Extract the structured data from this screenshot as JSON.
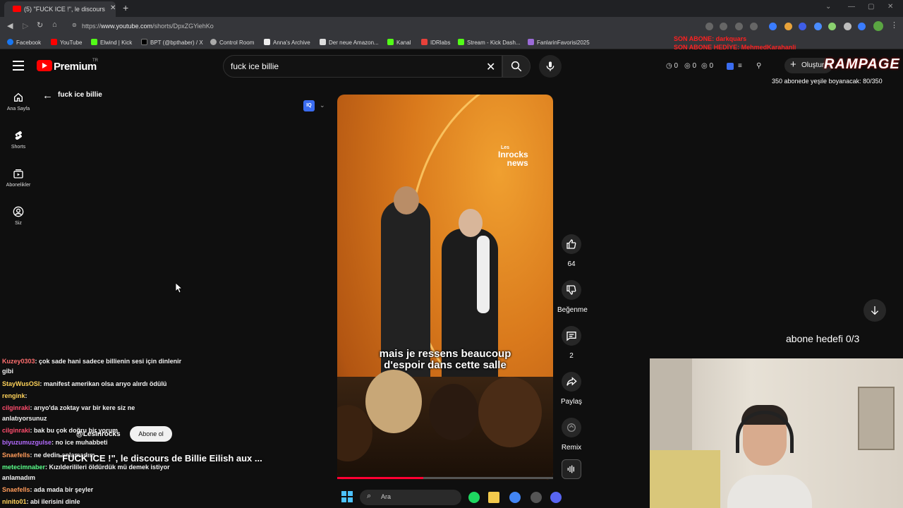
{
  "browser": {
    "tab_title": "(5) \"FUCK ICE !\", le discours",
    "url_prefix": "https://",
    "url_host": "www.youtube.com",
    "url_path": "/shorts/DpxZGYiehKo",
    "bookmarks": [
      "Facebook",
      "YouTube",
      "Elwind | Kick",
      "BPT (@bpthaber) / X",
      "Control Room",
      "Anna's Archive",
      "Der neue Amazon...",
      "Kanal",
      "IDRlabs",
      "Stream - Kick Dash...",
      "FanlarinFavorisi2025"
    ]
  },
  "header": {
    "brand": "Premium",
    "region": "TR",
    "search_value": "fuck ice billie",
    "stats": [
      "0",
      "0",
      "0"
    ],
    "create_label": "Oluştur"
  },
  "sidebar": {
    "items": [
      {
        "label": "Ana Sayfa",
        "icon": "home-icon"
      },
      {
        "label": "Shorts",
        "icon": "shorts-icon"
      },
      {
        "label": "Abonelikler",
        "icon": "subscriptions-icon"
      },
      {
        "label": "Siz",
        "icon": "account-icon"
      }
    ]
  },
  "page": {
    "title": "fuck ice billie"
  },
  "video": {
    "watermark_line1": "Les",
    "watermark_line2": "Inrocks",
    "watermark_line3": "news",
    "caption_line1": "mais je ressens beaucoup",
    "caption_line2": "d'espoir dans cette salle",
    "progress": 0.4,
    "channel": "@LesInrocks",
    "subscribe_label": "Abone ol",
    "title": "\"FUCK ICE !\", le discours de Billie Eilish aux ..."
  },
  "actions": {
    "like_count": "64",
    "dislike_label": "Beğenme",
    "comment_count": "2",
    "share_label": "Paylaş",
    "remix_label": "Remix"
  },
  "overlay": {
    "son_abone_1": "SON ABONE: darkquars",
    "son_abone_2": "SON ABONE HEDİYE: MehmedKarahanli",
    "rampage": "RAMPAGE",
    "goal_text": "350 abonede yeşile boyanacak: 80/350",
    "abone_hedefi": "abone hedefi 0/3"
  },
  "chat": [
    {
      "user": "Kuzey0303",
      "msg": ": çok sade hani sadece billienin sesi için dinlenir",
      "color": "#ff6f6f"
    },
    {
      "user": "",
      "msg": "gibi",
      "color": "#ffffff"
    },
    {
      "user": "StayWusOSI",
      "msg": ": manifest amerikan olsa arıyo alırdı ödülü",
      "color": "#ffd35a"
    },
    {
      "user": "rengink",
      "msg": ":",
      "color": "#ffd35a"
    },
    {
      "user": "cilginraki",
      "msg": ": arıyo'da zoktay var bir kere siz ne",
      "color": "#ff4d6d"
    },
    {
      "user": "",
      "msg": "anlatıyorsunuz",
      "color": "#ffffff"
    },
    {
      "user": "cilginraki",
      "msg": ": bak bu çok doğru bir yorum",
      "color": "#ff4d6d"
    },
    {
      "user": "biyuzumuzgulse",
      "msg": ": no ice muhabbeti",
      "color": "#b46bff"
    },
    {
      "user": "Snaefells",
      "msg": ": ne dedin anlamadım",
      "color": "#ff9b5a"
    },
    {
      "user": "metecimnaber",
      "msg": ": Kızılderilileri öldürdük mü demek istiyor",
      "color": "#5aff8a"
    },
    {
      "user": "",
      "msg": "anlamadım",
      "color": "#ffffff"
    },
    {
      "user": "Snaefells",
      "msg": ": ada mada bir şeyler",
      "color": "#ff9b5a"
    },
    {
      "user": "ninito01",
      "msg": ": abi ilerisini dinle",
      "color": "#ffd35a"
    }
  ],
  "taskbar": {
    "search_placeholder": "Ara"
  }
}
